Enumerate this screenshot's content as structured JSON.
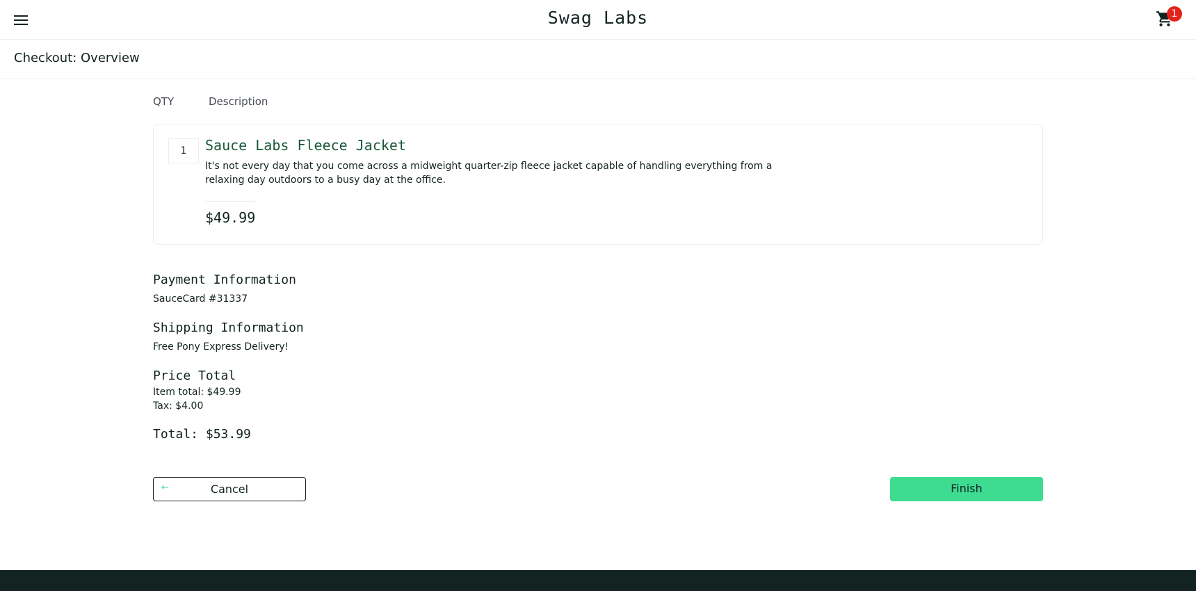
{
  "header": {
    "app_title": "Swag Labs",
    "menu_icon": "hamburger-menu-icon",
    "cart_icon": "shopping-cart-icon",
    "cart_count": "1"
  },
  "subheader": {
    "title": "Checkout: Overview"
  },
  "cart_list": {
    "qty_label": "QTY",
    "desc_label": "Description",
    "items": [
      {
        "quantity": "1",
        "name": "Sauce Labs Fleece Jacket",
        "description": "It's not every day that you come across a midweight quarter-zip fleece jacket capable of handling everything from a relaxing day outdoors to a busy day at the office.",
        "price": "$49.99"
      }
    ]
  },
  "summary": {
    "payment_label": "Payment Information",
    "payment_value": "SauceCard #31337",
    "shipping_label": "Shipping Information",
    "shipping_value": "Free Pony Express Delivery!",
    "price_total_label": "Price Total",
    "item_total": "Item total: $49.99",
    "tax": "Tax: $4.00",
    "total": "Total: $53.99"
  },
  "actions": {
    "cancel_label": "Cancel",
    "cancel_icon": "arrow-left-icon",
    "finish_label": "Finish"
  },
  "colors": {
    "accent": "#3ddc91",
    "item_title": "#18583a",
    "badge": "#e2231a",
    "footer": "#132322"
  }
}
